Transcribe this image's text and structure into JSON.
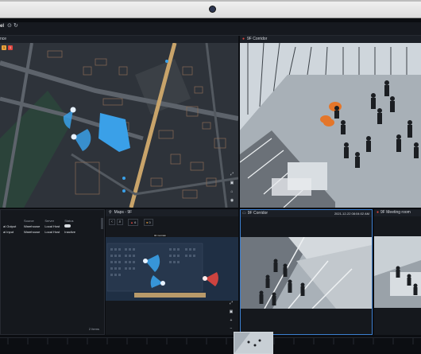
{
  "toolbar": {
    "title_fragment": "el"
  },
  "map_panel": {
    "label_fragment": "nce",
    "badge_a": "1",
    "badge_b": "1"
  },
  "corridor_top": {
    "label": "9F Corridor"
  },
  "table": {
    "columns": [
      "Source",
      "Server",
      "Status"
    ],
    "rows": [
      {
        "name": "al Output",
        "source": "Warehouse",
        "server": "Local Host",
        "status_icon": "toggle-icon"
      },
      {
        "name": "al Input",
        "source": "Warehouse",
        "server": "Local Host",
        "status": "Inactive"
      }
    ],
    "footer": "2 Items"
  },
  "floor_map": {
    "title": "Maps - 9F",
    "badge_red": "6",
    "badge_orange": "0",
    "tooltip": "9F Corridor"
  },
  "corridor_bottom": {
    "label": "9F Corridor",
    "timestamp": "2021-12-22 08:04:02 AM"
  },
  "meeting": {
    "label": "9F Meeting room"
  },
  "colors": {
    "selected_border": "#3c7fd0",
    "accent_red": "#e0463f",
    "accent_orange": "#e9a23b",
    "zone_blue": "#3aa0e8"
  }
}
